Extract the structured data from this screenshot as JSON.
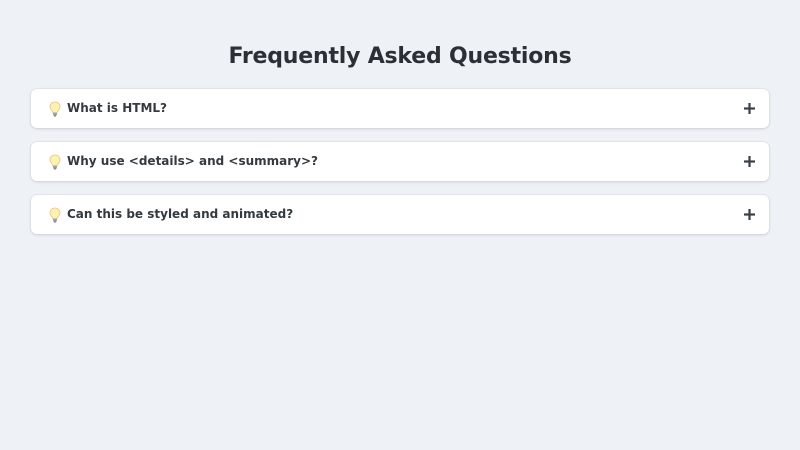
{
  "page": {
    "title": "Frequently Asked Questions"
  },
  "faq": {
    "items": [
      {
        "question": "What is HTML?",
        "icon": "lightbulb-icon",
        "toggle_icon": "plus-icon"
      },
      {
        "question": "Why use <details> and <summary>?",
        "icon": "lightbulb-icon",
        "toggle_icon": "plus-icon"
      },
      {
        "question": "Can this be styled and animated?",
        "icon": "lightbulb-icon",
        "toggle_icon": "plus-icon"
      }
    ]
  },
  "colors": {
    "background": "#eef2f7",
    "card": "#ffffff",
    "text": "#2d3339"
  }
}
